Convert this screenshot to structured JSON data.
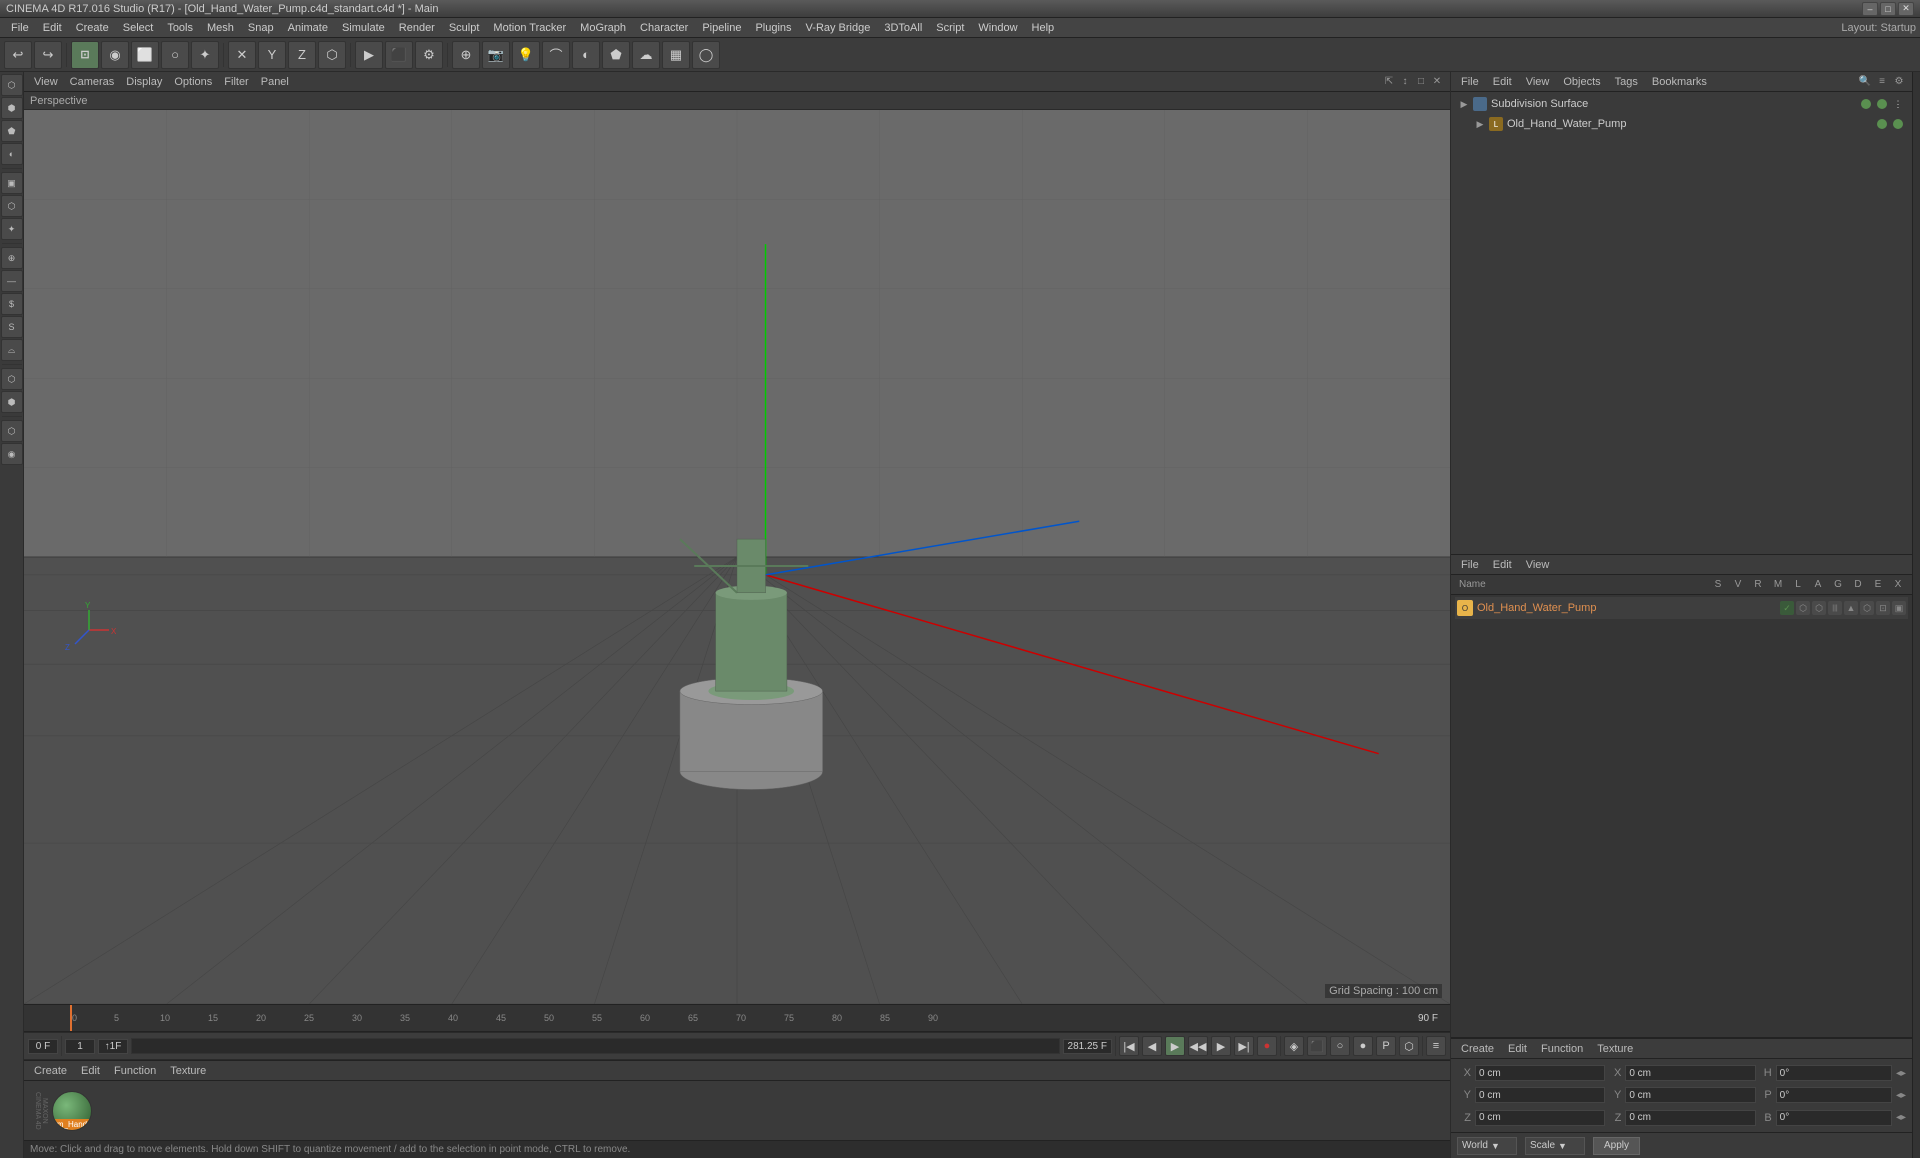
{
  "titlebar": {
    "text": "CINEMA 4D R17.016 Studio (R17) - [Old_Hand_Water_Pump.c4d_standart.c4d *] - Main",
    "minimize": "–",
    "maximize": "□",
    "close": "✕"
  },
  "menubar": {
    "items": [
      "File",
      "Edit",
      "Create",
      "Select",
      "Tools",
      "Mesh",
      "Snap",
      "Animate",
      "Simulate",
      "Render",
      "Sculpt",
      "Motion Tracker",
      "MoGraph",
      "Character",
      "Pipeline",
      "Plugins",
      "V-Ray Bridge",
      "3DToAll",
      "Script",
      "Window",
      "Help"
    ],
    "layout_label": "Layout:",
    "layout_value": "Startup"
  },
  "viewport": {
    "header_items": [
      "View",
      "Cameras",
      "Display",
      "Options",
      "Filter",
      "Panel"
    ],
    "label": "Perspective",
    "grid_spacing": "Grid Spacing : 100 cm"
  },
  "object_manager_top": {
    "header_items": [
      "File",
      "Edit",
      "View",
      "Objects",
      "Tags",
      "Bookmarks"
    ],
    "subdivision_surface": "Subdivision Surface",
    "water_pump": "Old_Hand_Water_Pump"
  },
  "object_manager_bottom": {
    "header_items": [
      "File",
      "Edit",
      "View"
    ],
    "columns": {
      "name": "Name",
      "s": "S",
      "v": "V",
      "r": "R",
      "m": "M",
      "l": "L",
      "a": "A",
      "g": "G",
      "d": "D",
      "e": "E",
      "x": "X"
    },
    "row": {
      "icon_color": "#e8b44a",
      "name": "Old_Hand_Water_Pump"
    }
  },
  "coords": {
    "header_items": [
      "Create",
      "Edit",
      "Function",
      "Texture"
    ],
    "x_label": "X",
    "y_label": "Y",
    "z_label": "Z",
    "x_val": "0 cm",
    "y_val": "0 cm",
    "z_val": "0 cm",
    "sx_label": "X",
    "sy_label": "Y",
    "sz_label": "Z",
    "sx_val": "0 cm",
    "sy_val": "0 cm",
    "sz_val": "0 cm",
    "h_label": "H",
    "p_label": "P",
    "b_label": "B",
    "h_val": "0°",
    "p_val": "0°",
    "b_val": "0°",
    "world_label": "World",
    "scale_label": "Scale",
    "apply_label": "Apply"
  },
  "material": {
    "header_items": [
      "Create",
      "Edit",
      "Function",
      "Texture"
    ],
    "mat_name": "m_Hand"
  },
  "timeline": {
    "frame_current": "0 F",
    "frame_end": "90 F",
    "frame_val": "0 F",
    "fps_val": "281.25 F",
    "markers": [
      "0",
      "5",
      "10",
      "15",
      "20",
      "25",
      "30",
      "35",
      "40",
      "45",
      "50",
      "55",
      "60",
      "65",
      "70",
      "75",
      "80",
      "85",
      "90"
    ]
  },
  "status_bar": {
    "text": "Move: Click and drag to move elements. Hold down SHIFT to quantize movement / add to the selection in point mode, CTRL to remove."
  },
  "toolbar": {
    "tools": [
      "↩",
      "↪",
      "⊕",
      "◉",
      "○",
      "⊞",
      "✕",
      "Y",
      "Z",
      "⬡",
      "▶",
      "▶▶",
      "⬛",
      "✲",
      "✦",
      "⬡",
      "⬢",
      "◐",
      "⬟",
      "☀",
      "✺",
      "◯",
      "⌇",
      "▦",
      "◉",
      "☁"
    ]
  }
}
